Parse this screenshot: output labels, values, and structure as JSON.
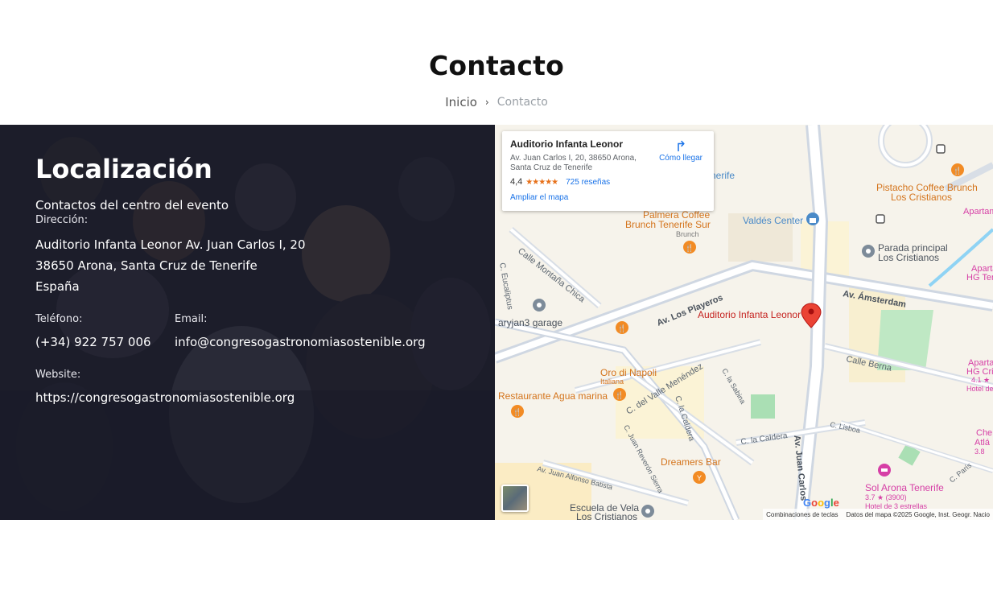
{
  "header": {
    "title": "Contacto",
    "breadcrumb": {
      "home": "Inicio",
      "current": "Contacto"
    }
  },
  "info": {
    "title": "Localización",
    "subtitle": "Contactos del centro del evento",
    "address_label": "Dirección:",
    "address_lines": [
      "Auditorio Infanta Leonor Av. Juan Carlos I, 20",
      "38650 Arona, Santa Cruz de Tenerife",
      "España"
    ],
    "phone_label": "Teléfono:",
    "phone": "(+34) 922 757 006",
    "email_label": "Email:",
    "email": "info@congresogastronomiasostenible.org",
    "website_label": "Website:",
    "website": "https://congresogastronomiasostenible.org"
  },
  "map": {
    "card": {
      "name": "Auditorio Infanta Leonor",
      "address": "Av. Juan Carlos I, 20, 38650 Arona, Santa Cruz de Tenerife",
      "rating": "4,4",
      "stars": "★★★★★",
      "reviews": "725 reseñas",
      "enlarge": "Ampliar el mapa",
      "directions": "Cómo llegar"
    },
    "labels": {
      "pistacho": "Pistacho Coffee Brunch",
      "pistacho2": "Los Cristianos",
      "apartam1": "Apartam",
      "nerife": "nerife",
      "palmera1": "Palmera Coffee",
      "palmera2": "Brunch Tenerife Sur",
      "brunch": "Brunch",
      "valdes": "Valdés Center",
      "parada1": "Parada principal",
      "parada2": "Los Cristianos",
      "apartam2a": "Apartan",
      "apartam2b": "HG Tene",
      "montana": "Calle Montaña Chica",
      "eucaliptus": "C. Eucaliptus",
      "garage": "aryjan3 garage",
      "playeros": "Av. Los Playeros",
      "auditorio": "Auditorio Infanta Leonor",
      "amsterdam": "Av. Ámsterdam",
      "berna": "Calle Berna",
      "apartam3a": "Apartam",
      "apartam3b": "HG Cristi",
      "apartam3c": "4.1 ★",
      "apartam3d": "Hotel de 3",
      "oro1": "Oro di Napoli",
      "oro2": "Italiana",
      "agua": "Restaurante Agua marina",
      "valle": "C. del Valle Menéndez",
      "sabina": "C. la Sabina",
      "caldera1": "C. la Caldera",
      "caldera2": "C. la Caldera",
      "lisboa": "C. Lisboa",
      "dreamers": "Dreamers Bar",
      "carlos": "Av. Juan Carlos",
      "reveron": "C. Juan Reverón Sierra",
      "alfonso": "Av. Juan Alfonso Batista",
      "escuela1": "Escuela de Vela",
      "escuela2": "Los Cristianos",
      "sol1": "Sol Arona Tenerife",
      "sol2": "3.7 ★ (3900)",
      "sol3": "Hotel de 3 estrellas",
      "che1": "Che",
      "che2": "Atlá",
      "che3": "3.8",
      "paris": "C. París",
      "li": "li"
    },
    "google": "Google",
    "footer_shortcuts": "Combinaciones de teclas",
    "footer_data": "Datos del mapa ©2025 Google, Inst. Geogr. Nacio"
  },
  "colors": {
    "marker_red": "#ea4335",
    "poi_orange": "#f28b24",
    "poi_gray": "#7d8b99",
    "hotel_pink": "#d63fa6",
    "link_blue": "#1a73e8"
  }
}
